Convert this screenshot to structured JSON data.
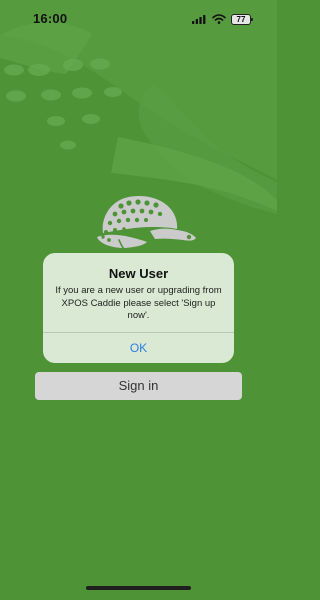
{
  "status_bar": {
    "time": "16:00",
    "battery": "77"
  },
  "dialog": {
    "title": "New User",
    "message": "If you are a new user or upgrading from XPOS Caddie please select 'Sign up now'.",
    "ok_label": "OK"
  },
  "signin_button": {
    "label": "Sign in"
  },
  "colors": {
    "background": "#4e9437",
    "dialog_background": "#d9e9d3",
    "accent_link": "#2f7de1",
    "signin_button": "#d6d6d6"
  },
  "icons": {
    "signal": "signal-bars-icon",
    "wifi": "wifi-icon",
    "battery": "battery-icon",
    "logo": "golf-cap-logo-icon"
  }
}
